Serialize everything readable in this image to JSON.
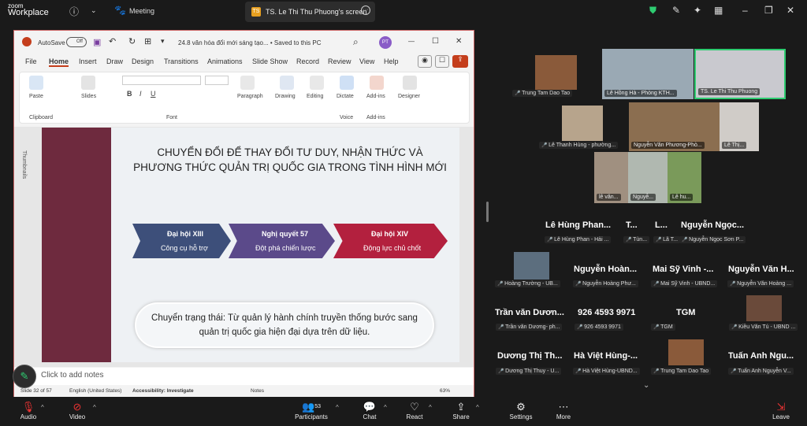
{
  "zoom": {
    "brand_line1": "zoom",
    "brand_line2": "Workplace",
    "meeting_label": "Meeting",
    "share_tab_badge": "TS",
    "share_tab_label": "TS. Le Thi Thu Phuong's screen"
  },
  "ppt": {
    "autosave": "AutoSave",
    "toggle": "Off",
    "doc_title": "24.8 văn hóa đổi mới sáng tạo... • Saved to this PC",
    "avatar": "PT",
    "menu": [
      "File",
      "Home",
      "Insert",
      "Draw",
      "Design",
      "Transitions",
      "Animations",
      "Slide Show",
      "Record",
      "Review",
      "View",
      "Help"
    ],
    "ribbon": {
      "paste": "Paste",
      "clipboard": "Clipboard",
      "slides": "Slides",
      "font": "Font",
      "paragraph": "Paragraph",
      "drawing": "Drawing",
      "editing": "Editing",
      "dictate": "Dictate",
      "voice": "Voice",
      "addins": "Add-ins",
      "addins_group": "Add-ins",
      "designer": "Designer"
    },
    "thumbnails": "Thumbnails",
    "slide": {
      "title_line1": "CHUYỂN ĐỔI ĐỂ THAY ĐỔI TƯ DUY, NHẬN THỨC VÀ",
      "title_line2": "PHƯƠNG THỨC QUẢN TRỊ QUỐC GIA TRONG TÌNH HÌNH MỚI",
      "arrows": [
        {
          "head": "Đại hội XIII",
          "sub": "Công cụ hỗ trợ",
          "color": "#3d4f7a"
        },
        {
          "head": "Nghị quyết 57",
          "sub": "Đột phá chiến lược",
          "color": "#5b4a8a"
        },
        {
          "head": "Đại hội XIV",
          "sub": "Động lực chủ chốt",
          "color": "#b3203e"
        }
      ],
      "bubble_line1": "Chuyển trạng thái: Từ quản lý hành chính truyền thống bước sang",
      "bubble_line2": "quản trị quốc gia hiện đại dựa trên dữ liệu."
    },
    "notes_placeholder": "Click to add notes",
    "status": {
      "slide": "Slide 32 of 57",
      "lang": "English (United States)",
      "access": "Accessibility: Investigate",
      "notes": "Notes",
      "zoom": "63%"
    }
  },
  "gallery": {
    "tiles": [
      {
        "name": "Trung Tam Dao Tao"
      },
      {
        "name": "Lê Hồng Hà - Phòng KTH..."
      },
      {
        "name": "TS. Le Thi Thu Phuong"
      },
      {
        "name": "Lê Thanh Hùng - phường..."
      },
      {
        "name": "Nguyễn Văn Phương-Phò..."
      },
      {
        "name": "Lê Thị..."
      },
      {
        "name": "lê văn..."
      },
      {
        "name": "Nguyễ..."
      },
      {
        "name": "Lê hu..."
      }
    ],
    "rows": [
      {
        "big": [
          "Lê Hùng Phan...",
          "T...",
          "L...",
          "Nguyễn Ngọc..."
        ],
        "small": [
          "Lê Hùng Phan - Hải ...",
          "Tùn...",
          "Lã T...",
          "Nguyễn Ngọc Sơn P..."
        ]
      },
      {
        "big": [
          "",
          "Nguyễn Hoàn...",
          "Mai Sỹ Vinh -...",
          "Nguyễn Văn H..."
        ],
        "small": [
          "Hoàng Trường - UB...",
          "Nguyễn Hoàng Phư...",
          "Mai Sỹ Vinh - UBND...",
          "Nguyễn Văn Hoàng ..."
        ]
      },
      {
        "big": [
          "Trần văn Dươn...",
          "926 4593 9971",
          "TGM",
          ""
        ],
        "small": [
          "Trần văn Dương- ph...",
          "926 4593 9971",
          "TGM",
          "Kiều Văn Tú - UBND ..."
        ]
      },
      {
        "big": [
          "Dương Thị Th...",
          "Hà Việt Hùng-...",
          "",
          "Tuấn Anh Ngu..."
        ],
        "small": [
          "Dương Thị Thuy - U...",
          "Hà Việt Hùng-UBND...",
          "Trung Tam Dao Tao",
          "Tuấn Anh Nguyễn V..."
        ]
      }
    ]
  },
  "toolbar": {
    "audio": "Audio",
    "video": "Video",
    "participants": "Participants",
    "participants_count": "53",
    "chat": "Chat",
    "react": "React",
    "share": "Share",
    "settings": "Settings",
    "more": "More",
    "leave": "Leave"
  }
}
